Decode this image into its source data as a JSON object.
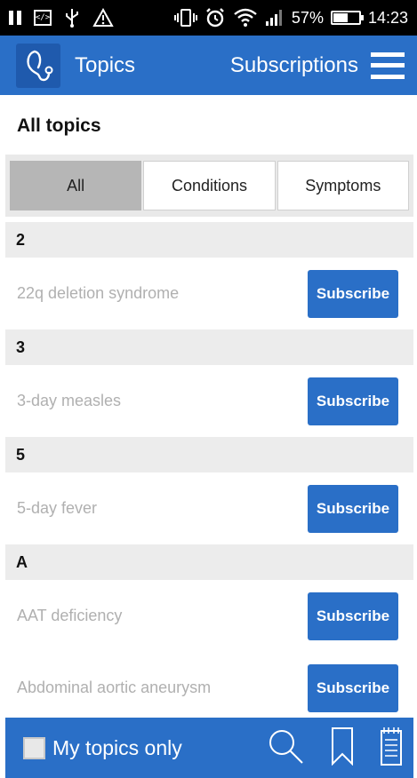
{
  "status_bar": {
    "battery_text": "57%",
    "battery_level": 0.57,
    "time": "14:23"
  },
  "app_bar": {
    "title": "Topics",
    "subscriptions_label": "Subscriptions"
  },
  "page": {
    "title": "All topics"
  },
  "tabs": [
    {
      "label": "All",
      "active": true
    },
    {
      "label": "Conditions",
      "active": false
    },
    {
      "label": "Symptoms",
      "active": false
    }
  ],
  "sections": [
    {
      "header": "2",
      "items": [
        {
          "label": "22q deletion syndrome",
          "button": "Subscribe"
        }
      ]
    },
    {
      "header": "3",
      "items": [
        {
          "label": "3-day measles",
          "button": "Subscribe"
        }
      ]
    },
    {
      "header": "5",
      "items": [
        {
          "label": "5-day fever",
          "button": "Subscribe"
        }
      ]
    },
    {
      "header": "A",
      "items": [
        {
          "label": "AAT deficiency",
          "button": "Subscribe"
        },
        {
          "label": "Abdominal aortic aneurysm",
          "button": "Subscribe"
        }
      ]
    }
  ],
  "bottom_bar": {
    "my_topics_label": "My topics only",
    "my_topics_checked": false,
    "icons": [
      "search-icon",
      "bookmark-icon",
      "notepad-icon"
    ]
  },
  "colors": {
    "primary": "#2a6fc7",
    "section_bg": "#ececec",
    "active_tab": "#b6b6b6",
    "muted_text": "#b0b0b0"
  }
}
